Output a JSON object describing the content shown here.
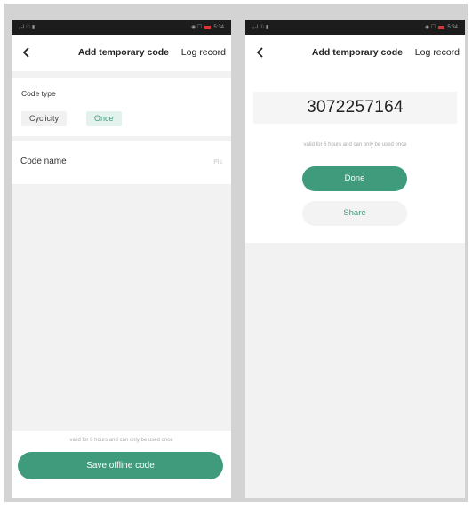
{
  "status_bar": {
    "left": "₂₄l ☉ ▮",
    "right": "◉ ☐",
    "time": "5:34"
  },
  "left_screen": {
    "title": "Add temporary code",
    "action": "Log record",
    "code_type": {
      "label": "Code type",
      "options": [
        "Cyclicity",
        "Once"
      ],
      "selected": "Once"
    },
    "code_name": {
      "label": "Code name",
      "placeholder": "Pls"
    },
    "note": "valid for 6 hours and can only be used once",
    "save_label": "Save offline code"
  },
  "right_screen": {
    "title": "Add temporary code",
    "action": "Log record",
    "code": "3072257164",
    "note": "valid for 6 hours and can only be used once",
    "done_label": "Done",
    "share_label": "Share"
  },
  "colors": {
    "accent": "#3f9b7c",
    "accent_light": "#e3f2ec",
    "background": "#f2f2f2",
    "frame": "#d3d3d3"
  },
  "icons": {
    "back": "chevron-left-icon"
  }
}
